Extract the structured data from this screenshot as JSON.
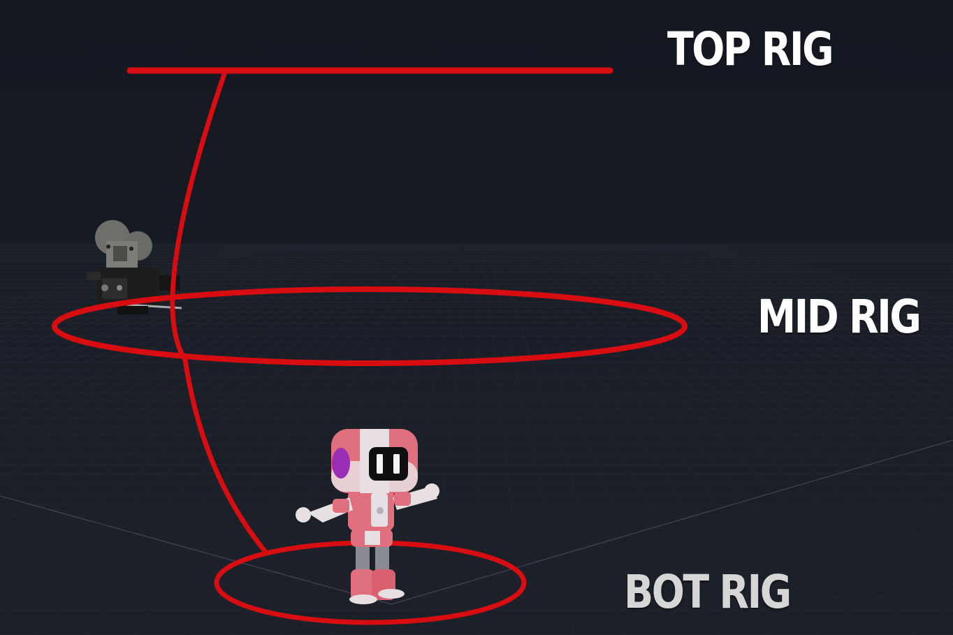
{
  "labels": {
    "top": "TOP RIG",
    "mid": "MID RIG",
    "bot": "BOT RIG"
  },
  "colors": {
    "background": "#131720",
    "floor_grid": "#2a303b",
    "rig_orbit": "#d80d12",
    "robot_pink": "#e1707f",
    "robot_white": "#e8dfe2",
    "robot_visor_accent": "#9a2fb5",
    "camera_body": "#1b1b1b"
  },
  "icons": {
    "camera": "film-camera-icon",
    "character": "robot-character"
  }
}
